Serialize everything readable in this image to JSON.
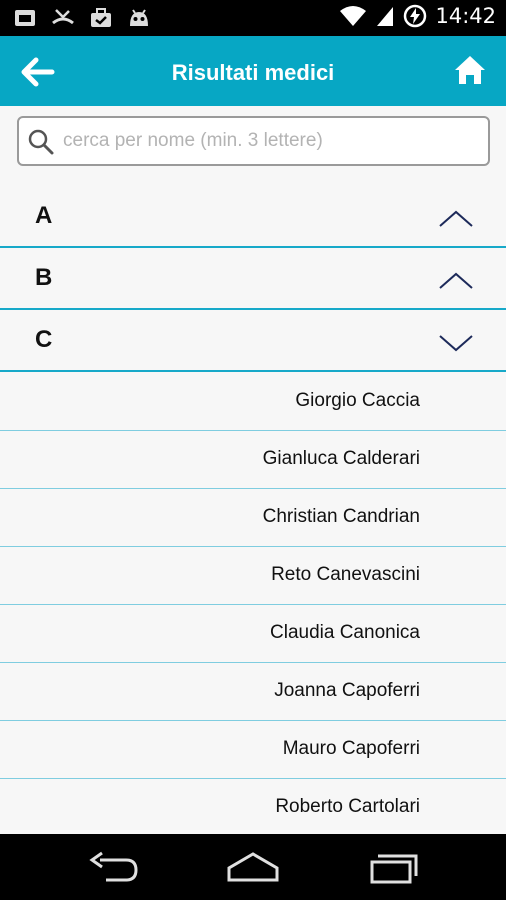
{
  "statusbar": {
    "time": "14:42"
  },
  "appbar": {
    "title": "Risultati medici"
  },
  "search": {
    "placeholder": "cerca per nome (min. 3 lettere)"
  },
  "sections": [
    {
      "letter": "A",
      "expanded": false
    },
    {
      "letter": "B",
      "expanded": false
    },
    {
      "letter": "C",
      "expanded": true
    }
  ],
  "doctors": [
    "Giorgio Caccia",
    "Gianluca Calderari",
    "Christian Candrian",
    "Reto Canevascini",
    "Claudia Canonica",
    "Joanna Capoferri",
    "Mauro Capoferri",
    "Roberto Cartolari"
  ],
  "colors": {
    "accent": "#07a7c4",
    "divider": "#17a9c9"
  }
}
